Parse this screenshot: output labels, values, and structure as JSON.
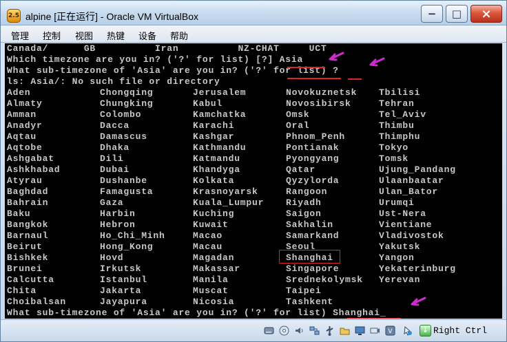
{
  "window": {
    "app_icon_text": "2.5",
    "title": "alpine [正在运行] - Oracle VM VirtualBox",
    "buttons": {
      "minimize": "−",
      "maximize": "□",
      "close": "×"
    }
  },
  "menu": {
    "items": [
      "管理",
      "控制",
      "视图",
      "热键",
      "设备",
      "帮助"
    ]
  },
  "terminal": {
    "lines": [
      "Canada/      GB          Iran          NZ-CHAT     UCT",
      "Which timezone are you in? ('?' for list) [?] Asia",
      "What sub-timezone of 'Asia' are you in? ('?' for list) ?",
      "ls: Asia/: No such file or directory",
      "What sub-timezone of 'Asia' are you in? ('?' for list) Shanghai_"
    ],
    "timezones": [
      [
        "Aden",
        "Chongqing",
        "Jerusalem",
        "Novokuznetsk",
        "Tbilisi"
      ],
      [
        "Almaty",
        "Chungking",
        "Kabul",
        "Novosibirsk",
        "Tehran"
      ],
      [
        "Amman",
        "Colombo",
        "Kamchatka",
        "Omsk",
        "Tel_Aviv"
      ],
      [
        "Anadyr",
        "Dacca",
        "Karachi",
        "Oral",
        "Thimbu"
      ],
      [
        "Aqtau",
        "Damascus",
        "Kashgar",
        "Phnom_Penh",
        "Thimphu"
      ],
      [
        "Aqtobe",
        "Dhaka",
        "Kathmandu",
        "Pontianak",
        "Tokyo"
      ],
      [
        "Ashgabat",
        "Dili",
        "Katmandu",
        "Pyongyang",
        "Tomsk"
      ],
      [
        "Ashkhabad",
        "Dubai",
        "Khandyga",
        "Qatar",
        "Ujung_Pandang"
      ],
      [
        "Atyrau",
        "Dushanbe",
        "Kolkata",
        "Qyzylorda",
        "Ulaanbaatar"
      ],
      [
        "Baghdad",
        "Famagusta",
        "Krasnoyarsk",
        "Rangoon",
        "Ulan_Bator"
      ],
      [
        "Bahrain",
        "Gaza",
        "Kuala_Lumpur",
        "Riyadh",
        "Urumqi"
      ],
      [
        "Baku",
        "Harbin",
        "Kuching",
        "Saigon",
        "Ust-Nera"
      ],
      [
        "Bangkok",
        "Hebron",
        "Kuwait",
        "Sakhalin",
        "Vientiane"
      ],
      [
        "Barnaul",
        "Ho_Chi_Minh",
        "Macao",
        "Samarkand",
        "Vladivostok"
      ],
      [
        "Beirut",
        "Hong_Kong",
        "Macau",
        "Seoul",
        "Yakutsk"
      ],
      [
        "Bishkek",
        "Hovd",
        "Magadan",
        "Shanghai",
        "Yangon"
      ],
      [
        "Brunei",
        "Irkutsk",
        "Makassar",
        "Singapore",
        "Yekaterinburg"
      ],
      [
        "Calcutta",
        "Istanbul",
        "Manila",
        "Srednekolymsk",
        "Yerevan"
      ],
      [
        "Chita",
        "Jakarta",
        "Muscat",
        "Taipei",
        ""
      ],
      [
        "Choibalsan",
        "Jayapura",
        "Nicosia",
        "Tashkent",
        ""
      ]
    ],
    "colors": {
      "text": "#c8c8c8",
      "background": "#000000",
      "annotation": "#e02424",
      "arrows": "#d12ad1"
    }
  },
  "statusbar": {
    "icons": [
      "hard-disk-icon",
      "optical-drive-icon",
      "audio-icon",
      "network-icon",
      "usb-icon",
      "shared-folder-icon",
      "display-icon",
      "video-capture-icon",
      "virtualization-icon",
      "mouse-integration-icon",
      "keyboard-capture-icon"
    ],
    "host_key": "Right Ctrl"
  }
}
